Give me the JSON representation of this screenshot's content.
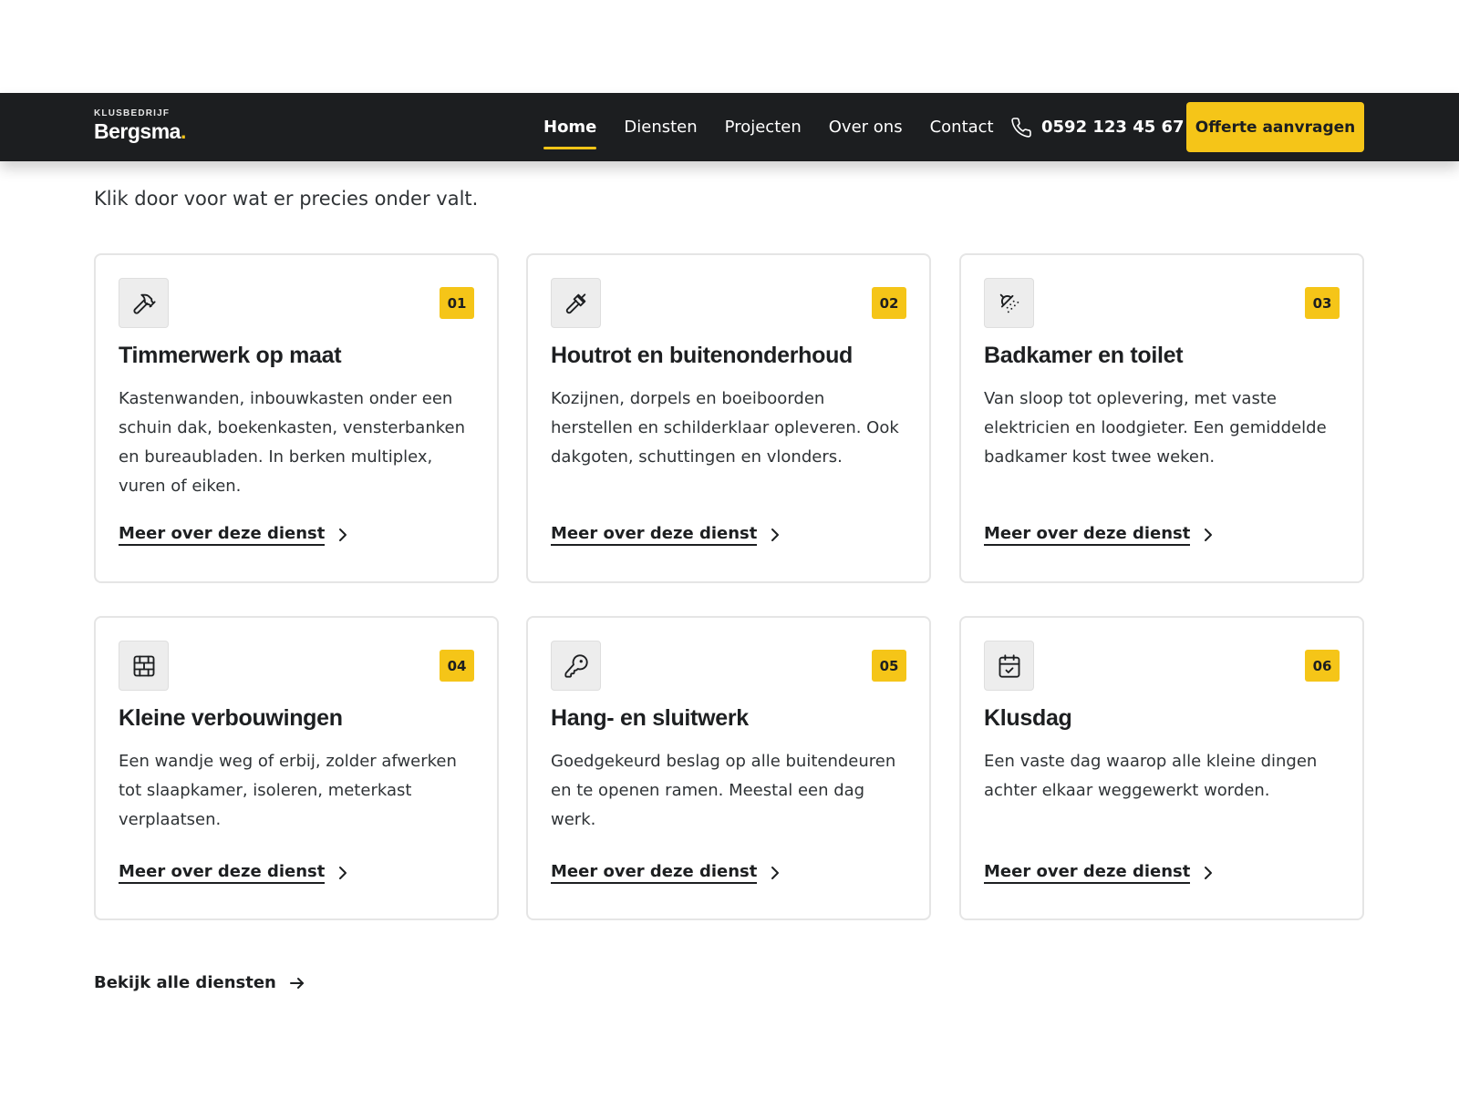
{
  "brand": {
    "kicker": "KLUSBEDRIJF",
    "name": "Bergsma",
    "dot": "."
  },
  "nav": {
    "items": [
      "Home",
      "Diensten",
      "Projecten",
      "Over ons",
      "Contact"
    ],
    "active": "Home",
    "phone": "0592 123 45 67",
    "cta": "Offerte aanvragen"
  },
  "section": {
    "subtitle": "Klik door voor wat er precies onder valt."
  },
  "services": [
    {
      "num": "01",
      "icon": "hammer-icon",
      "title": "Timmerwerk op maat",
      "desc": "Kastenwanden, inbouwkasten onder een schuin dak, boekenkasten, vensterbanken en bureaubladen. In berken multiplex, vuren of eiken.",
      "link": "Meer over deze dienst"
    },
    {
      "num": "02",
      "icon": "paintbrush-icon",
      "title": "Houtrot en buitenonderhoud",
      "desc": "Kozijnen, dorpels en boeiboorden herstellen en schilderklaar opleveren. Ook dakgoten, schuttingen en vlonders.",
      "link": "Meer over deze dienst"
    },
    {
      "num": "03",
      "icon": "shower-icon",
      "title": "Badkamer en toilet",
      "desc": "Van sloop tot oplevering, met vaste elektricien en loodgieter. Een gemiddelde badkamer kost twee weken.",
      "link": "Meer over deze dienst"
    },
    {
      "num": "04",
      "icon": "brick-wall-icon",
      "title": "Kleine verbouwingen",
      "desc": "Een wandje weg of erbij, zolder afwerken tot slaapkamer, isoleren, meterkast verplaatsen.",
      "link": "Meer over deze dienst"
    },
    {
      "num": "05",
      "icon": "key-icon",
      "title": "Hang- en sluitwerk",
      "desc": "Goedgekeurd beslag op alle buitendeuren en te openen ramen. Meestal een dag werk.",
      "link": "Meer over deze dienst"
    },
    {
      "num": "06",
      "icon": "calendar-check-icon",
      "title": "Klusdag",
      "desc": "Een vaste dag waarop alle kleine dingen achter elkaar weggewerkt worden.",
      "link": "Meer over deze dienst"
    }
  ],
  "all_link": "Bekijk alle diensten",
  "colors": {
    "accent": "#f5c518",
    "navbar": "#1c1e20",
    "text": "#1d1f21"
  }
}
